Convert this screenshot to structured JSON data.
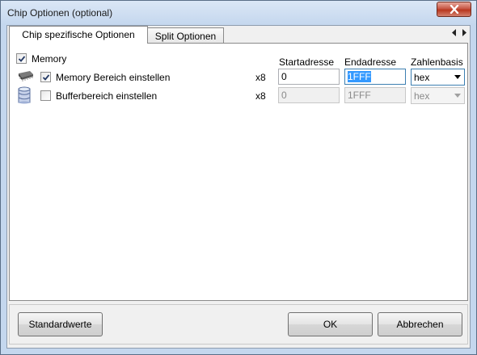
{
  "window": {
    "title": "Chip Optionen (optional)"
  },
  "tabs": [
    {
      "label": "Chip spezifische Optionen",
      "active": true
    },
    {
      "label": "Split Optionen",
      "active": false
    }
  ],
  "memory": {
    "label": "Memory",
    "checked": true
  },
  "columns": {
    "start": "Startadresse",
    "end": "Endadresse",
    "base": "Zahlenbasis"
  },
  "rows": [
    {
      "icon": "memory-chip-icon",
      "label": "Memory Bereich einstellen",
      "checked": true,
      "multiplier": "x8",
      "start": "0",
      "end": "1FFF",
      "base": "hex",
      "enabled": true
    },
    {
      "icon": "buffer-database-icon",
      "label": "Bufferbereich einstellen",
      "checked": false,
      "multiplier": "x8",
      "start": "0",
      "end": "1FFF",
      "base": "hex",
      "enabled": false
    }
  ],
  "buttons": {
    "defaults": "Standardwerte",
    "ok": "OK",
    "cancel": "Abbrechen"
  },
  "colors": {
    "selection": "#3399ff",
    "close_button": "#c75745"
  }
}
